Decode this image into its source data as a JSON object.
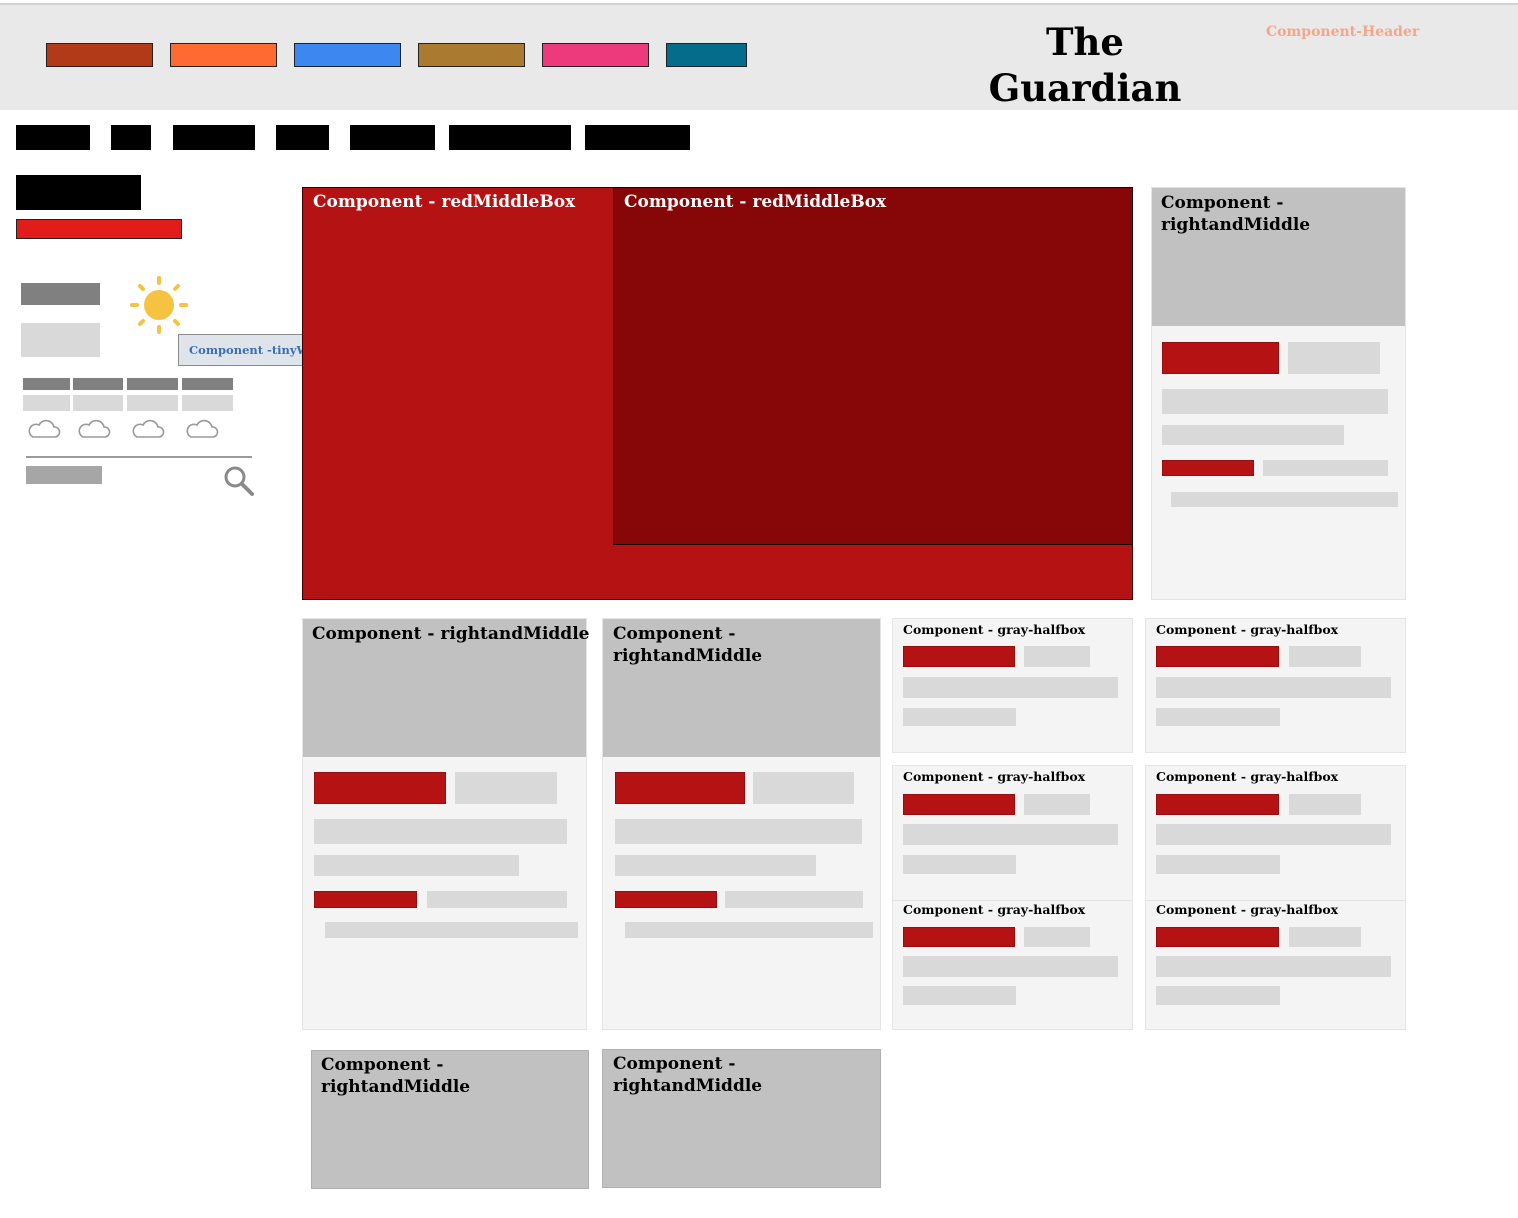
{
  "header": {
    "logo_line1": "The",
    "logo_line2": "Guardian",
    "component_label": "Component-Header",
    "swatch_colors": [
      "#b23a18",
      "#ff6a33",
      "#3d87f0",
      "#a97a2f",
      "#ec3a7c",
      "#056c8c"
    ]
  },
  "weather": {
    "tooltip": "Component -tinyWeatherBox",
    "sun_color": "#f5c242",
    "icons": [
      "sun-icon",
      "cloud-icon",
      "search-icon"
    ]
  },
  "main": {
    "red_box_outer_label": "Component - redMiddleBox",
    "red_box_inner_label": "Component - redMiddleBox",
    "red_color": "#b51214",
    "dark_red_color": "#870608"
  },
  "right_and_middle": {
    "label": "Component - rightandMiddle",
    "label_line1": "Component -",
    "label_line2": "rightandMiddle"
  },
  "halfbox": {
    "label": "Component - gray-halfbox"
  }
}
